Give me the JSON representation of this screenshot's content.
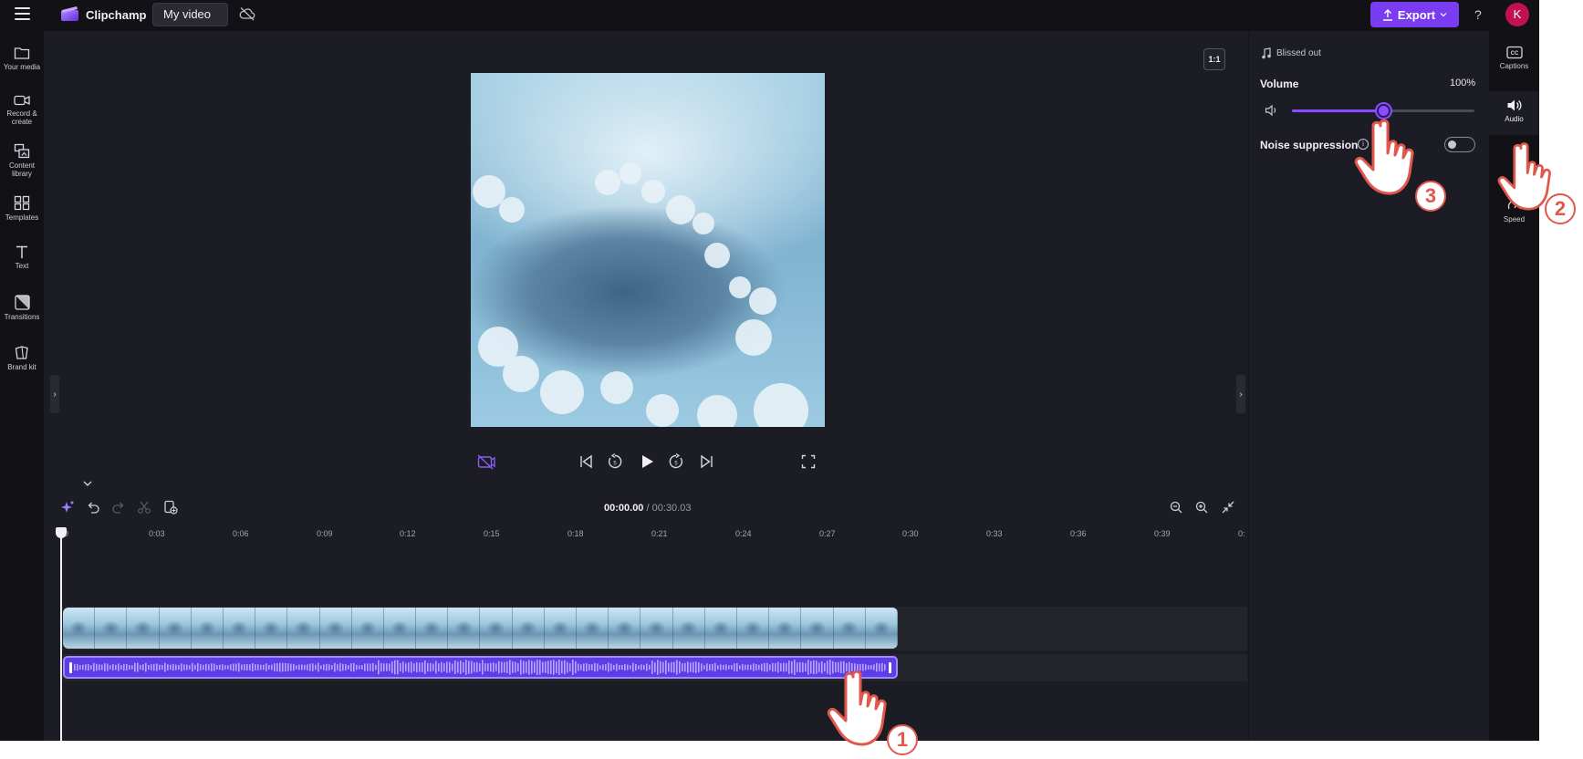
{
  "topbar": {
    "app_name": "Clipchamp",
    "project_title": "My video",
    "export_label": "Export",
    "help_label": "?",
    "avatar_initial": "K"
  },
  "left_sidebar": {
    "items": [
      {
        "label": "Your media",
        "icon": "folder-icon"
      },
      {
        "label": "Record & create",
        "icon": "video-camera-icon"
      },
      {
        "label": "Content library",
        "icon": "content-library-icon"
      },
      {
        "label": "Templates",
        "icon": "templates-icon"
      },
      {
        "label": "Text",
        "icon": "text-icon"
      },
      {
        "label": "Transitions",
        "icon": "transitions-icon"
      },
      {
        "label": "Brand kit",
        "icon": "brand-kit-icon"
      }
    ]
  },
  "preview": {
    "aspect_ratio_label": "1:1",
    "image_description_icon": "sky-clouds-image"
  },
  "timeline": {
    "current_time": "00:00.00",
    "separator": "/",
    "total_time": "00:30.03",
    "ruler_ticks": [
      "0",
      "0:03",
      "0:06",
      "0:09",
      "0:12",
      "0:15",
      "0:18",
      "0:21",
      "0:24",
      "0:27",
      "0:30",
      "0:33",
      "0:36",
      "0:39",
      "0:"
    ]
  },
  "audio_panel": {
    "track_name": "Blissed out",
    "volume_label": "Volume",
    "volume_value": "100%",
    "volume_level": 0.5,
    "noise_suppression_label": "Noise suppression",
    "noise_suppression_on": false
  },
  "right_rail": {
    "items": [
      {
        "label": "Captions",
        "icon": "captions-icon"
      },
      {
        "label": "Audio",
        "icon": "speaker-icon"
      },
      {
        "label": "Speed",
        "icon": "speed-icon"
      }
    ]
  },
  "tutorial_steps": [
    "1",
    "2",
    "3"
  ],
  "colors": {
    "accent": "#7a3cf0",
    "audio_clip": "#5b3ee6",
    "background": "#1c1c24",
    "step_badge": "#e2574c"
  }
}
